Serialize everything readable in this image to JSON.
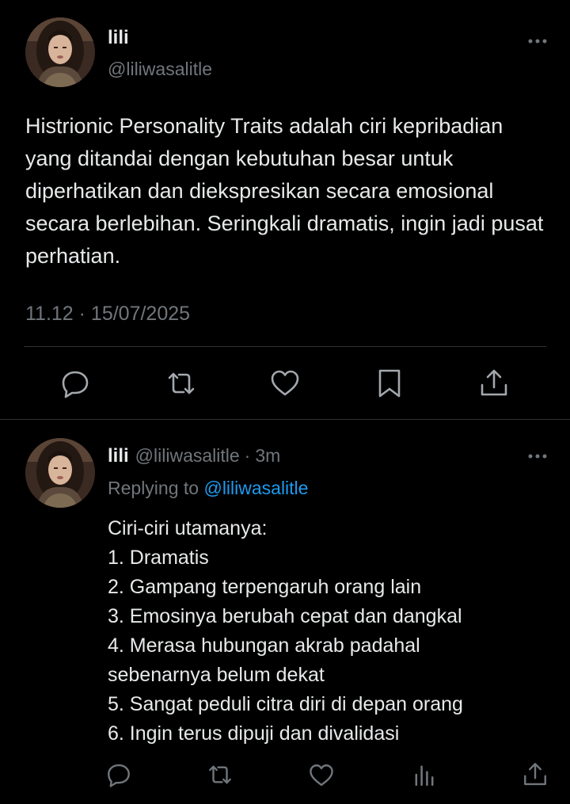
{
  "main_tweet": {
    "author": {
      "display_name": "lili",
      "handle": "@liliwasalitle"
    },
    "text": "Histrionic Personality Traits adalah ciri kepribadian yang ditandai dengan kebutuhan besar untuk diperhatikan dan diekspresikan secara emosional secara berlebihan. Seringkali dramatis, ingin jadi pusat perhatian.",
    "timestamp": "11.12 · 15/07/2025",
    "actions": [
      "reply-icon",
      "retweet-icon",
      "like-icon",
      "bookmark-icon",
      "share-icon"
    ]
  },
  "reply_tweet": {
    "author": {
      "display_name": "lili",
      "handle": "@liliwasalitle"
    },
    "separator": "·",
    "time_ago": "3m",
    "replying_prefix": "Replying to ",
    "replying_handle": "@liliwasalitle",
    "lines": [
      "Ciri-ciri utamanya:",
      "1. Dramatis",
      "2. Gampang terpengaruh orang lain",
      "3. Emosinya berubah cepat dan dangkal",
      "4. Merasa hubungan akrab padahal",
      "sebenarnya belum dekat",
      "5. Sangat peduli citra diri di depan orang",
      "6. Ingin terus dipuji dan divalidasi"
    ],
    "actions": [
      "reply-icon",
      "retweet-icon",
      "like-icon",
      "views-icon",
      "share-icon"
    ]
  },
  "colors": {
    "background": "#000000",
    "text_primary": "#e7e9ea",
    "text_secondary": "#71767b",
    "accent": "#1d9bf0",
    "divider": "#2f3336"
  }
}
